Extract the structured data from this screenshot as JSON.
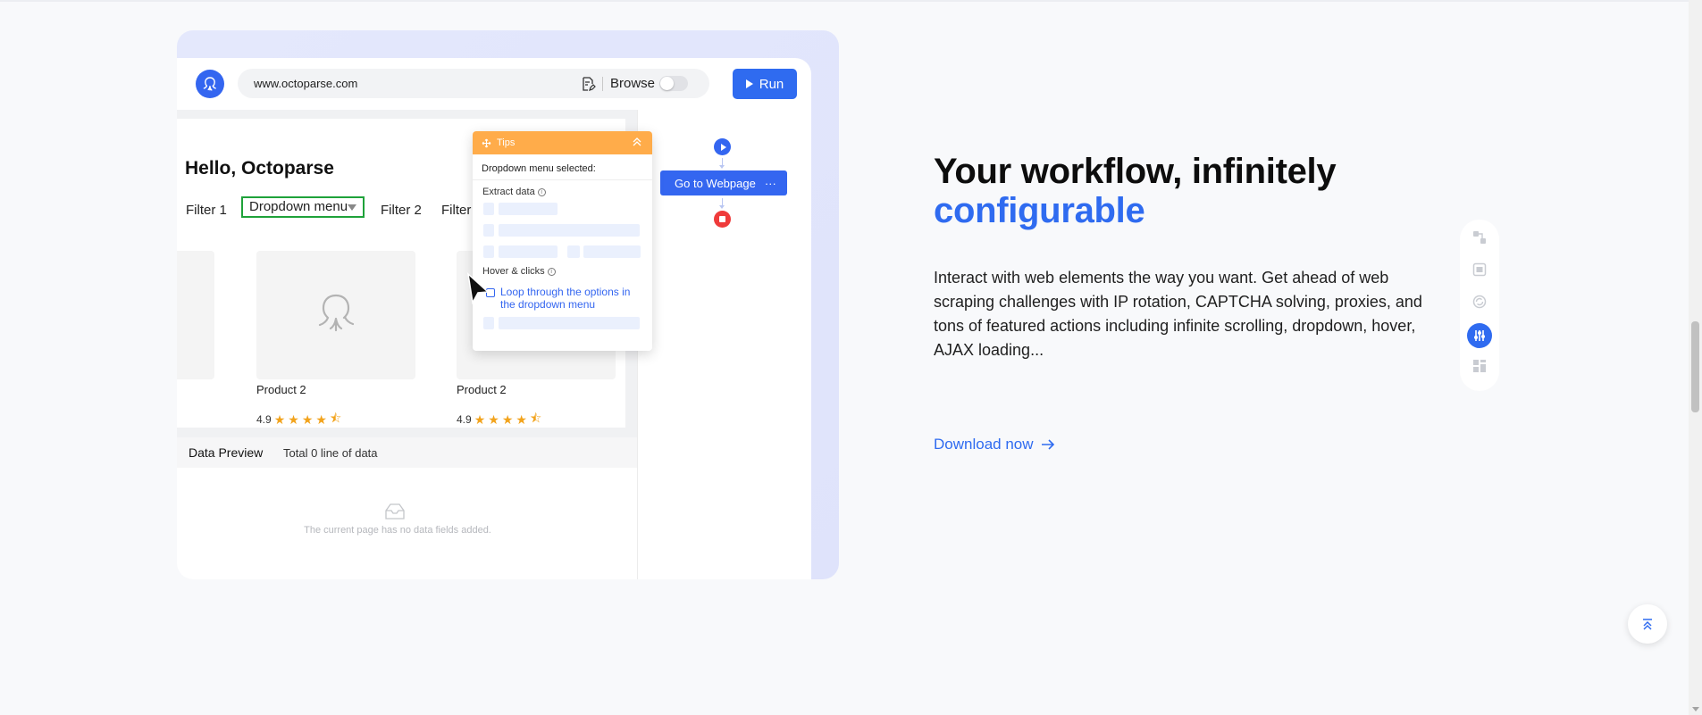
{
  "demo": {
    "url": "www.octoparse.com",
    "browse_label": "Browse",
    "run_label": "Run",
    "page_heading": "Hello, Octoparse",
    "filters": [
      "Filter 1",
      "Filter 2",
      "Filter"
    ],
    "dropdown_label": "Dropdown menu",
    "products": [
      {
        "name": "Product 2",
        "rating": "4.9"
      },
      {
        "name": "Product 2",
        "rating": "4.9"
      }
    ],
    "data_preview": {
      "title": "Data Preview",
      "count": "Total 0 line of data",
      "empty_message": "The current page has no data fields added."
    },
    "workflow": {
      "step": "Go to Webpage",
      "more": "···"
    },
    "tips": {
      "title": "Tips",
      "subtitle": "Dropdown menu selected:",
      "extract_label": "Extract data",
      "hover_label": "Hover & clicks",
      "loop_option": "Loop through the options in the dropdown menu"
    }
  },
  "section": {
    "headline": "Your workflow, infinitely",
    "headline_accent": "configurable",
    "description": "Interact with web elements the way you want. Get ahead of web scraping challenges with IP rotation, CAPTCHA solving, proxies, and tons of featured actions including infinite scrolling, dropdown, hover, AJAX loading...",
    "cta": "Download now"
  },
  "side_nav": {
    "icons": [
      "workflow-icon",
      "capture-icon",
      "ip-rotation-icon",
      "configure-icon",
      "template-icon"
    ],
    "active_index": 3
  },
  "colors": {
    "accent": "#2f6bf0",
    "tips_header": "#ffac4a",
    "selected_outline": "#1fa23a",
    "stop": "#ef3b3b",
    "star": "#f2a31c"
  }
}
